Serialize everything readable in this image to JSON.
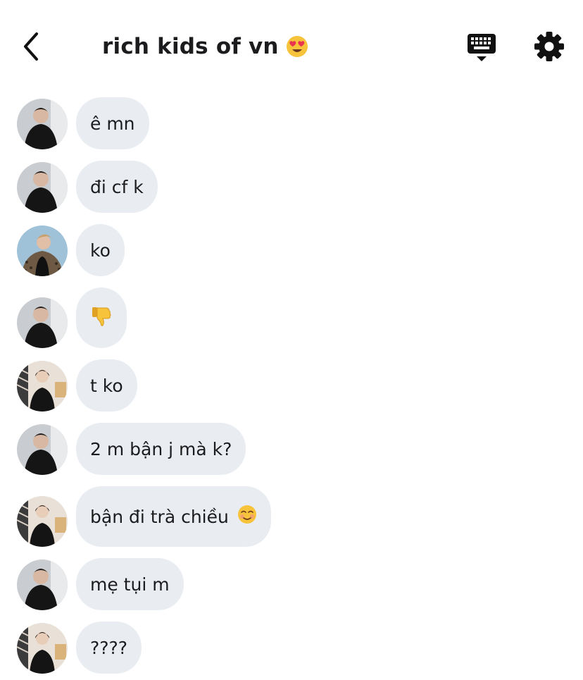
{
  "header": {
    "title": "rich kids of vn",
    "title_emoji": "heart-eyes-emoji",
    "back_icon": "chevron-left-icon",
    "keyboard_icon": "keyboard-hide-icon",
    "settings_icon": "gear-icon"
  },
  "messages": [
    {
      "sender": "a",
      "text": "ê mn",
      "emoji": ""
    },
    {
      "sender": "a",
      "text": "đi cf k",
      "emoji": ""
    },
    {
      "sender": "b",
      "text": "ko",
      "emoji": ""
    },
    {
      "sender": "a",
      "text": "",
      "emoji": "thumbs-down-emoji"
    },
    {
      "sender": "c",
      "text": "t ko",
      "emoji": ""
    },
    {
      "sender": "a",
      "text": "2 m bận j mà k?",
      "emoji": ""
    },
    {
      "sender": "c",
      "text": "bận đi trà chiều",
      "emoji": "smiling-blush-emoji"
    },
    {
      "sender": "a",
      "text": "mẹ tụi m",
      "emoji": ""
    },
    {
      "sender": "c",
      "text": "????",
      "emoji": ""
    }
  ],
  "colors": {
    "bubble": "#e9edf2",
    "text": "#1c1c1e",
    "emoji_yellow": "#f6c33b"
  }
}
